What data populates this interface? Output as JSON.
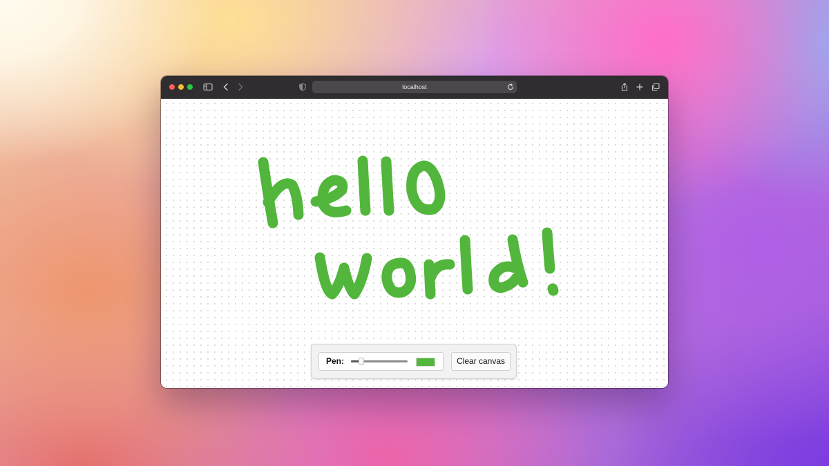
{
  "browser": {
    "url": "localhost",
    "icons": {
      "sidebar": "sidebar-toggle-icon",
      "back": "back-chevron-icon",
      "forward": "forward-chevron-icon",
      "privacy": "privacy-shield-icon",
      "reload": "reload-icon",
      "share": "share-icon",
      "new_tab": "plus-icon",
      "tabs": "tab-overview-icon"
    }
  },
  "canvas": {
    "ink_color": "#52b63c",
    "drawn_text": "hello world!"
  },
  "toolbar": {
    "pen_label": "Pen:",
    "pen_size_fraction": 0.18,
    "pen_color": "#52b63c",
    "clear_label": "Clear canvas"
  },
  "colors": {
    "titlebar": "#2f2d2f",
    "close": "#fe5f57",
    "minimize": "#febc2e",
    "zoom": "#28c840"
  }
}
